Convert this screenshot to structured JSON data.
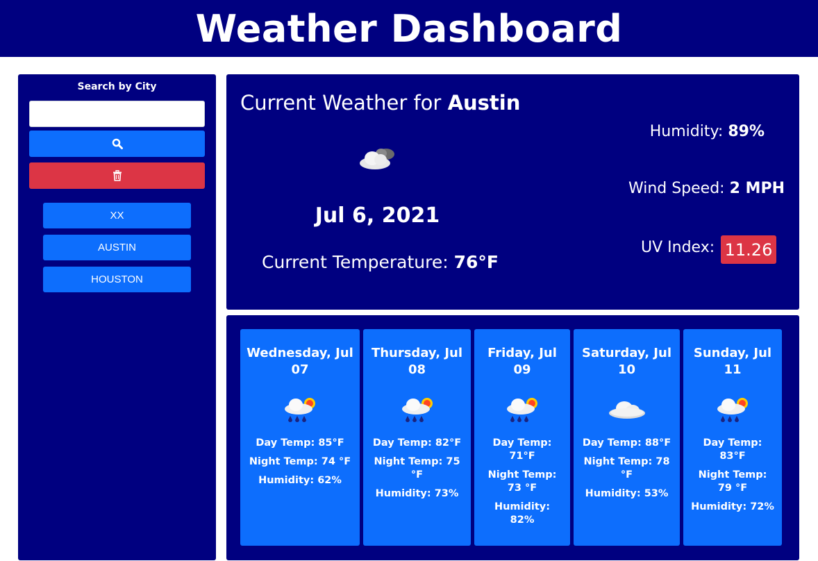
{
  "header": {
    "title": "Weather Dashboard"
  },
  "sidebar": {
    "search_label": "Search by City",
    "search_value": "",
    "search_button_icon": "search-icon",
    "clear_button_icon": "trash-icon",
    "history": [
      "XX",
      "AUSTIN",
      "HOUSTON"
    ]
  },
  "current": {
    "title_prefix": "Current Weather for ",
    "city": "Austin",
    "icon": "partly-cloudy-icon",
    "date": "Jul 6, 2021",
    "temp_label": "Current Temperature: ",
    "temp_value": "76°F",
    "humidity_label": "Humidity: ",
    "humidity_value": "89%",
    "wind_label": "Wind Speed: ",
    "wind_value": "2 MPH",
    "uv_label": "UV Index:",
    "uv_value": "11.26"
  },
  "forecast": [
    {
      "date": "Wednesday, Jul 07",
      "icon": "rain-sun-icon",
      "day": "Day Temp: 85°F",
      "night": "Night Temp: 74 °F",
      "humidity": "Humidity: 62%"
    },
    {
      "date": "Thursday, Jul 08",
      "icon": "rain-sun-icon",
      "day": "Day Temp: 82°F",
      "night": "Night Temp: 75 °F",
      "humidity": "Humidity: 73%"
    },
    {
      "date": "Friday, Jul 09",
      "icon": "rain-sun-icon",
      "day": "Day Temp: 71°F",
      "night": "Night Temp: 73 °F",
      "humidity": "Humidity: 82%"
    },
    {
      "date": "Saturday, Jul 10",
      "icon": "cloud-icon",
      "day": "Day Temp: 88°F",
      "night": "Night Temp: 78 °F",
      "humidity": "Humidity: 53%"
    },
    {
      "date": "Sunday, Jul 11",
      "icon": "rain-sun-icon",
      "day": "Day Temp: 83°F",
      "night": "Night Temp: 79 °F",
      "humidity": "Humidity: 72%"
    }
  ],
  "colors": {
    "navy": "#000080",
    "primary": "#0d6efd",
    "danger": "#dc3545"
  }
}
